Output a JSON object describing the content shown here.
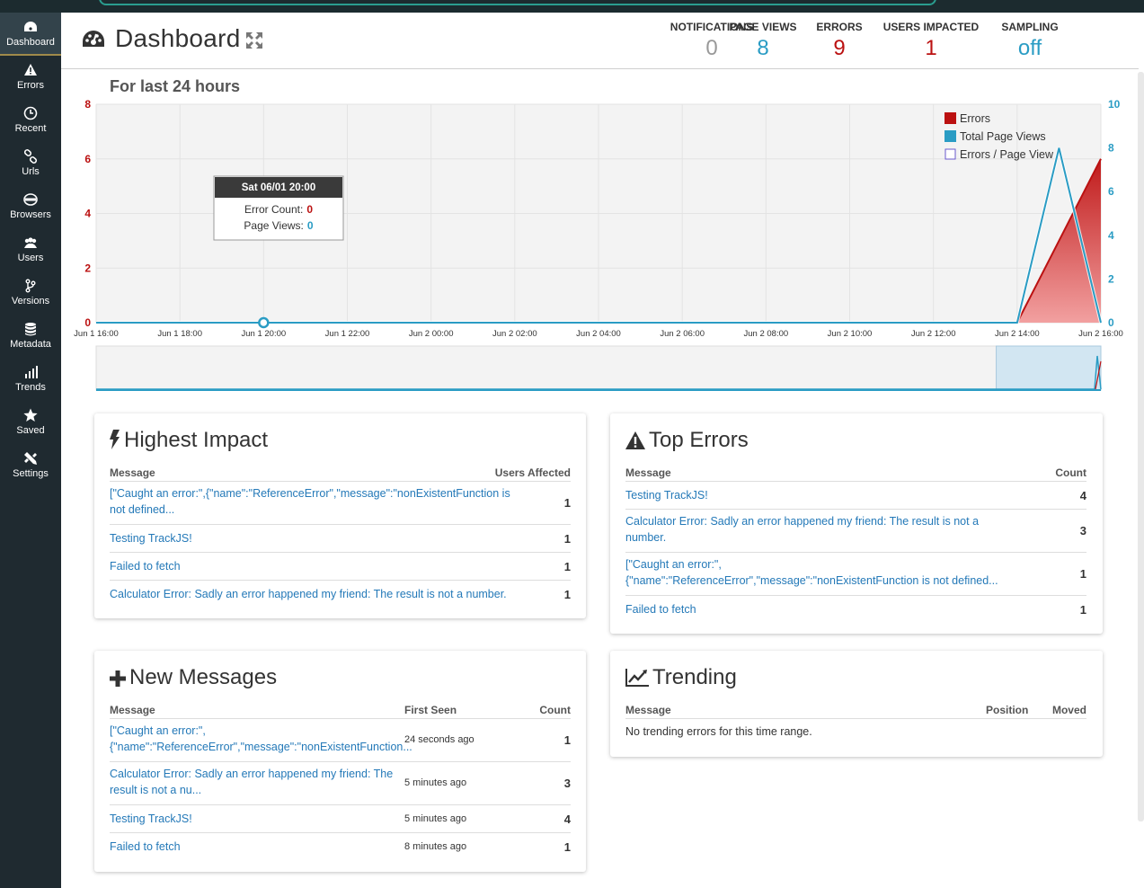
{
  "sidebar": {
    "items": [
      {
        "label": "Dashboard",
        "icon": "dashboard-icon",
        "active": true
      },
      {
        "label": "Errors",
        "icon": "warning-icon"
      },
      {
        "label": "Recent",
        "icon": "clock-icon"
      },
      {
        "label": "Urls",
        "icon": "link-icon"
      },
      {
        "label": "Browsers",
        "icon": "globe-icon"
      },
      {
        "label": "Users",
        "icon": "users-icon"
      },
      {
        "label": "Versions",
        "icon": "branch-icon"
      },
      {
        "label": "Metadata",
        "icon": "database-icon"
      },
      {
        "label": "Trends",
        "icon": "bar-chart-icon"
      },
      {
        "label": "Saved",
        "icon": "star-icon"
      },
      {
        "label": "Settings",
        "icon": "tools-icon"
      }
    ]
  },
  "header": {
    "title": "Dashboard",
    "stats": [
      {
        "label": "NOTIFICATIONS",
        "value": "0",
        "color": "#999999"
      },
      {
        "label": "PAGE VIEWS",
        "value": "8",
        "color": "#2a9cc4"
      },
      {
        "label": "ERRORS",
        "value": "9",
        "color": "#bb1111"
      },
      {
        "label": "USERS IMPACTED",
        "value": "1",
        "color": "#bb1111"
      },
      {
        "label": "SAMPLING",
        "value": "off",
        "color": "#2a9cc4"
      }
    ]
  },
  "chart_title": "For last 24 hours",
  "chart_data": {
    "type": "area",
    "x": [
      "Jun 1 16:00",
      "Jun 1 18:00",
      "Jun 1 20:00",
      "Jun 1 22:00",
      "Jun 2 00:00",
      "Jun 2 02:00",
      "Jun 2 04:00",
      "Jun 2 06:00",
      "Jun 2 08:00",
      "Jun 2 10:00",
      "Jun 2 12:00",
      "Jun 2 14:00",
      "Jun 2 16:00"
    ],
    "y_left": {
      "ticks": [
        "0",
        "2",
        "4",
        "6",
        "8"
      ],
      "ylim": [
        0,
        8
      ],
      "color": "#bb1111"
    },
    "y_right": {
      "ticks": [
        "0",
        "2",
        "4",
        "6",
        "8",
        "10"
      ],
      "ylim": [
        0,
        10
      ],
      "color": "#2a9cc4"
    },
    "series": [
      {
        "name": "Errors",
        "color": "#bb1111",
        "axis": "left",
        "points": [
          [
            0,
            0
          ],
          [
            22,
            0
          ],
          [
            24,
            6
          ]
        ]
      },
      {
        "name": "Total Page Views",
        "color": "#2a9cc4",
        "axis": "right",
        "points": [
          [
            0,
            0
          ],
          [
            22,
            0
          ],
          [
            23,
            8
          ],
          [
            24,
            0
          ]
        ]
      },
      {
        "name": "Errors / Page View",
        "color": "#6a5acd",
        "axis": "left",
        "points": []
      }
    ],
    "tooltip": {
      "title": "Sat 06/01 20:00",
      "error_label": "Error Count:",
      "error_value": "0",
      "pv_label": "Page Views:",
      "pv_value": "0",
      "x_hours": 4
    },
    "legend_position": "top-right",
    "grid": true
  },
  "panels": {
    "highest_impact": {
      "title": "Highest Impact",
      "col_message": "Message",
      "col_count": "Users Affected",
      "rows": [
        {
          "message": "[\"Caught an error:\",{\"name\":\"ReferenceError\",\"message\":\"nonExistentFunction is not defined...",
          "count": "1"
        },
        {
          "message": "Testing TrackJS!",
          "count": "1"
        },
        {
          "message": "Failed to fetch",
          "count": "1"
        },
        {
          "message": "Calculator Error: Sadly an error happened my friend: The result is not a number.",
          "count": "1"
        }
      ]
    },
    "top_errors": {
      "title": "Top Errors",
      "col_message": "Message",
      "col_count": "Count",
      "rows": [
        {
          "message": "Testing TrackJS!",
          "count": "4"
        },
        {
          "message": "Calculator Error: Sadly an error happened my friend: The result is not a number.",
          "count": "3"
        },
        {
          "message": "[\"Caught an error:\",{\"name\":\"ReferenceError\",\"message\":\"nonExistentFunction is not defined...",
          "count": "1"
        },
        {
          "message": "Failed to fetch",
          "count": "1"
        }
      ]
    },
    "new_messages": {
      "title": "New Messages",
      "col_message": "Message",
      "col_seen": "First Seen",
      "col_count": "Count",
      "rows": [
        {
          "message": "[\"Caught an error:\",{\"name\":\"ReferenceError\",\"message\":\"nonExistentFunction...",
          "seen": "24 seconds ago",
          "count": "1"
        },
        {
          "message": "Calculator Error: Sadly an error happened my friend: The result is not a nu...",
          "seen": "5 minutes ago",
          "count": "3"
        },
        {
          "message": "Testing TrackJS!",
          "seen": "5 minutes ago",
          "count": "4"
        },
        {
          "message": "Failed to fetch",
          "seen": "8 minutes ago",
          "count": "1"
        }
      ]
    },
    "trending": {
      "title": "Trending",
      "col_message": "Message",
      "col_position": "Position",
      "col_moved": "Moved",
      "empty_text": "No trending errors for this time range."
    }
  }
}
